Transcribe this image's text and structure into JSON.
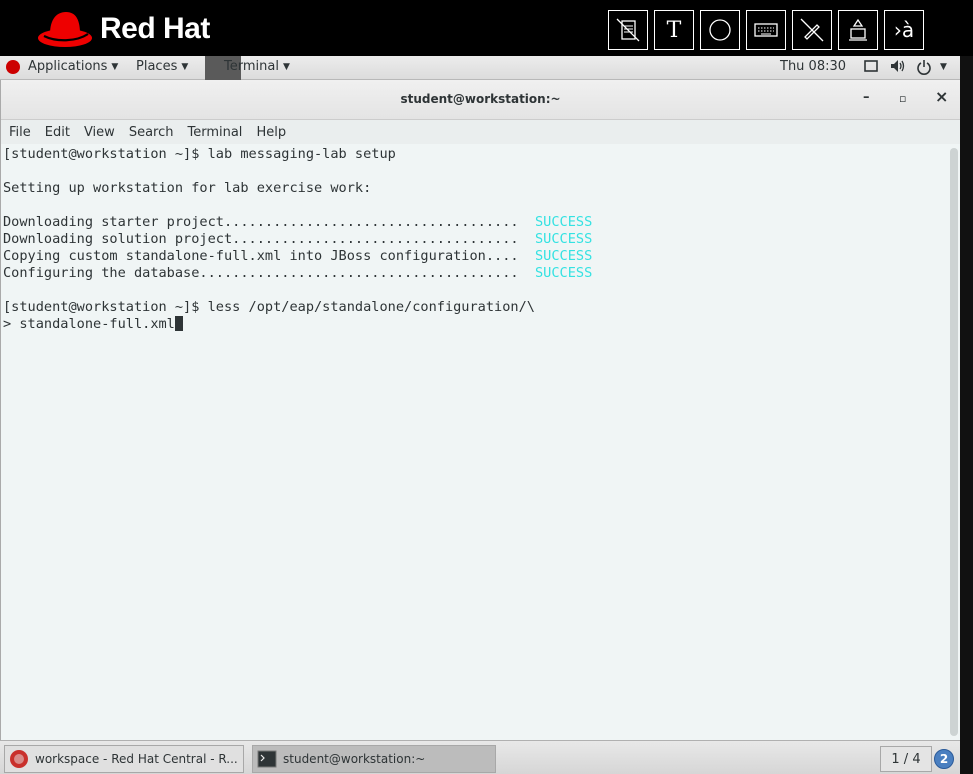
{
  "banner": {
    "brand": "Red Hat",
    "tools": [
      {
        "icon": "document-crossed-icon",
        "label": ""
      },
      {
        "icon": "text-icon",
        "label": "T"
      },
      {
        "icon": "circle-icon",
        "label": ""
      },
      {
        "icon": "keyboard-icon",
        "label": ""
      },
      {
        "icon": "pen-crossed-icon",
        "label": ""
      },
      {
        "icon": "eject-icon",
        "label": ""
      },
      {
        "icon": "language-icon",
        "label": "›à"
      }
    ]
  },
  "topbar": {
    "applications": "Applications",
    "places": "Places",
    "terminal": "Terminal",
    "clock": "Thu 08:30"
  },
  "window": {
    "title": "student@workstation:~",
    "controls": {
      "minimize": "–",
      "maximize": "▫",
      "close": "×"
    },
    "menu": [
      "File",
      "Edit",
      "View",
      "Search",
      "Terminal",
      "Help"
    ]
  },
  "terminal": {
    "lines": [
      {
        "text": "[student@workstation ~]$ lab messaging-lab setup",
        "status": ""
      },
      {
        "text": "",
        "status": ""
      },
      {
        "text": "Setting up workstation for lab exercise work:",
        "status": ""
      },
      {
        "text": "",
        "status": ""
      },
      {
        "text": "Downloading starter project....................................  ",
        "status": "SUCCESS"
      },
      {
        "text": "Downloading solution project...................................  ",
        "status": "SUCCESS"
      },
      {
        "text": "Copying custom standalone-full.xml into JBoss configuration....  ",
        "status": "SUCCESS"
      },
      {
        "text": "Configuring the database.......................................  ",
        "status": "SUCCESS"
      },
      {
        "text": "",
        "status": ""
      },
      {
        "text": "[student@workstation ~]$ less /opt/eap/standalone/configuration/\\",
        "status": ""
      },
      {
        "text": "> standalone-full.xml",
        "status": "",
        "cursor": true
      }
    ]
  },
  "taskbar": {
    "tasks": [
      "workspace - Red Hat Central - R...",
      "student@workstation:~"
    ],
    "pager": "1 / 4",
    "badge": "2"
  }
}
